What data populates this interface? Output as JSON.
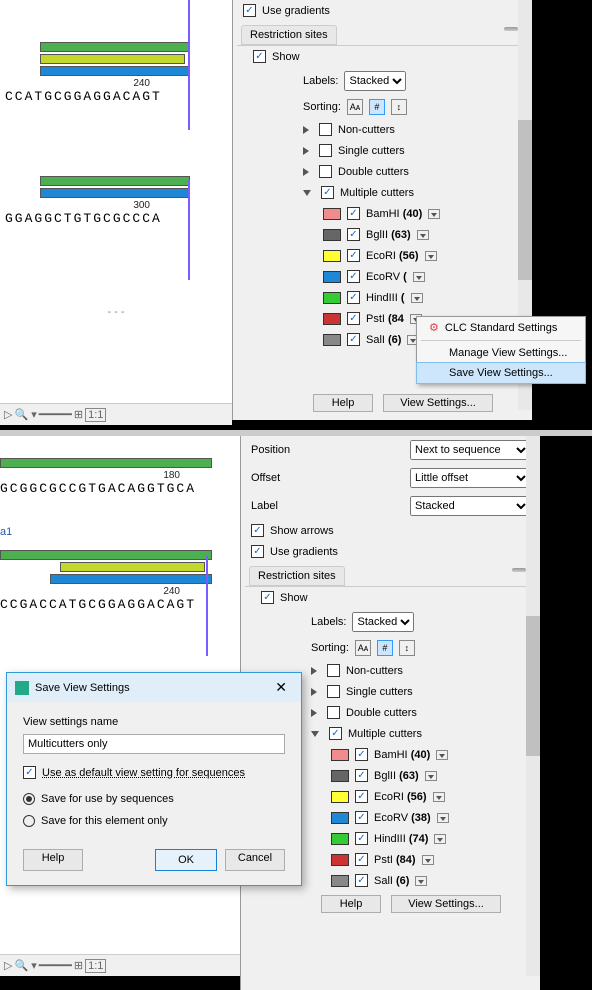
{
  "top": {
    "use_gradients": "Use gradients",
    "panel_title": "Restriction sites",
    "show": "Show",
    "labels_label": "Labels:",
    "labels_value": "Stacked",
    "sorting_label": "Sorting:",
    "non_cutters": "Non-cutters",
    "single_cutters": "Single cutters",
    "double_cutters": "Double cutters",
    "multiple_cutters": "Multiple cutters",
    "enzymes": [
      {
        "color": "#f28c8c",
        "name": "BamHI",
        "count": "(40)"
      },
      {
        "color": "#666666",
        "name": "BglII",
        "count": "(63)"
      },
      {
        "color": "#ffff33",
        "name": "EcoRI",
        "count": "(56)"
      },
      {
        "color": "#1e88d6",
        "name": "EcoRV",
        "count": "("
      },
      {
        "color": "#33cc33",
        "name": "HindIII",
        "count": "("
      },
      {
        "color": "#cc3333",
        "name": "PstI",
        "count": "(84"
      },
      {
        "color": "#888888",
        "name": "SalI",
        "count": "(6)"
      }
    ],
    "help": "Help",
    "view_settings": "View Settings...",
    "ctx": {
      "standard": "CLC Standard Settings",
      "manage": "Manage View Settings...",
      "save": "Save View Settings..."
    },
    "seq1_num": "240",
    "seq1_text": "CCATGCGGAGGACAGT",
    "seq2_num": "300",
    "seq2_text": "GGAGGCTGTGCGCCCA",
    "dashes": "- - -"
  },
  "bottom": {
    "position_label": "Position",
    "position_value": "Next to sequence",
    "offset_label": "Offset",
    "offset_value": "Little offset",
    "label_label": "Label",
    "label_value": "Stacked",
    "show_arrows": "Show arrows",
    "use_gradients": "Use gradients",
    "panel_title": "Restriction sites",
    "show": "Show",
    "labels_label": "Labels:",
    "labels_value": "Stacked",
    "sorting_label": "Sorting:",
    "non_cutters": "Non-cutters",
    "single_cutters": "Single cutters",
    "double_cutters": "Double cutters",
    "multiple_cutters": "Multiple cutters",
    "enzymes": [
      {
        "color": "#f28c8c",
        "name": "BamHI",
        "count": "(40)"
      },
      {
        "color": "#666666",
        "name": "BglII",
        "count": "(63)"
      },
      {
        "color": "#ffff33",
        "name": "EcoRI",
        "count": "(56)"
      },
      {
        "color": "#1e88d6",
        "name": "EcoRV",
        "count": "(38)"
      },
      {
        "color": "#33cc33",
        "name": "HindIII",
        "count": "(74)"
      },
      {
        "color": "#cc3333",
        "name": "PstI",
        "count": "(84)"
      },
      {
        "color": "#888888",
        "name": "SalI",
        "count": "(6)"
      }
    ],
    "help": "Help",
    "view_settings": "View Settings...",
    "seq1_num": "180",
    "seq1_text": "GCGGCGCCGTGACAGGTGCA",
    "seq_label": "a1",
    "seq2_num": "240",
    "seq2_text": "CCGACCATGCGGAGGACAGT",
    "dialog": {
      "title": "Save View Settings",
      "name_label": "View settings name",
      "name_value": "Multicutters only",
      "cb_default": "Use as default view setting for sequences",
      "rb_all": "Save for use by sequences",
      "rb_this": "Save for this element only",
      "help": "Help",
      "ok": "OK",
      "cancel": "Cancel"
    }
  },
  "chart_data": {
    "type": "table",
    "title": "Restriction enzyme cut counts",
    "series": [
      {
        "name": "BamHI",
        "value": 40
      },
      {
        "name": "BglII",
        "value": 63
      },
      {
        "name": "EcoRI",
        "value": 56
      },
      {
        "name": "EcoRV",
        "value": 38
      },
      {
        "name": "HindIII",
        "value": 74
      },
      {
        "name": "PstI",
        "value": 84
      },
      {
        "name": "SalI",
        "value": 6
      }
    ]
  }
}
